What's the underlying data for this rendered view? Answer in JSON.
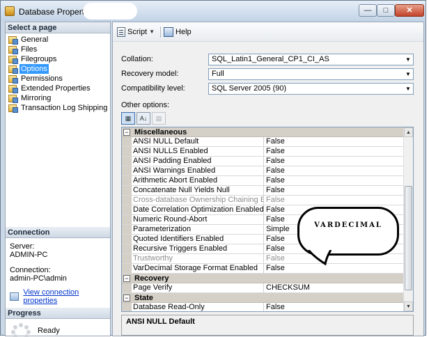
{
  "window": {
    "title": "Database Properties"
  },
  "title_buttons": {
    "minimize": "—",
    "maximize": "□",
    "close": "✕"
  },
  "left_pane": {
    "select_page_header": "Select a page",
    "pages": [
      {
        "label": "General",
        "selected": false
      },
      {
        "label": "Files",
        "selected": false
      },
      {
        "label": "Filegroups",
        "selected": false
      },
      {
        "label": "Options",
        "selected": true
      },
      {
        "label": "Permissions",
        "selected": false
      },
      {
        "label": "Extended Properties",
        "selected": false
      },
      {
        "label": "Mirroring",
        "selected": false
      },
      {
        "label": "Transaction Log Shipping",
        "selected": false
      }
    ],
    "connection_header": "Connection",
    "server_label": "Server:",
    "server_value": "ADMIN-PC",
    "connection_label": "Connection:",
    "connection_value": "admin-PC\\admin",
    "view_connection_link": "View connection properties",
    "progress_header": "Progress",
    "progress_status": "Ready"
  },
  "toolbar": {
    "script_label": "Script",
    "help_label": "Help"
  },
  "form": {
    "collation_label": "Collation:",
    "collation_value": "SQL_Latin1_General_CP1_CI_AS",
    "recovery_label": "Recovery model:",
    "recovery_value": "Full",
    "compat_label": "Compatibility level:",
    "compat_value": "SQL Server 2005 (90)",
    "other_options_label": "Other options:"
  },
  "property_grid": {
    "categories": [
      {
        "name": "Miscellaneous",
        "rows": [
          {
            "name": "ANSI NULL Default",
            "value": "False",
            "disabled": false
          },
          {
            "name": "ANSI NULLS Enabled",
            "value": "False",
            "disabled": false
          },
          {
            "name": "ANSI Padding Enabled",
            "value": "False",
            "disabled": false
          },
          {
            "name": "ANSI Warnings Enabled",
            "value": "False",
            "disabled": false
          },
          {
            "name": "Arithmetic Abort Enabled",
            "value": "False",
            "disabled": false
          },
          {
            "name": "Concatenate Null Yields Null",
            "value": "False",
            "disabled": false
          },
          {
            "name": "Cross-database Ownership Chaining Enabled",
            "value": "False",
            "disabled": true
          },
          {
            "name": "Date Correlation Optimization Enabled",
            "value": "False",
            "disabled": false
          },
          {
            "name": "Numeric Round-Abort",
            "value": "False",
            "disabled": false
          },
          {
            "name": "Parameterization",
            "value": "Simple",
            "disabled": false
          },
          {
            "name": "Quoted Identifiers Enabled",
            "value": "False",
            "disabled": false
          },
          {
            "name": "Recursive Triggers Enabled",
            "value": "False",
            "disabled": false
          },
          {
            "name": "Trustworthy",
            "value": "False",
            "disabled": true
          },
          {
            "name": "VarDecimal Storage Format Enabled",
            "value": "False",
            "disabled": false
          }
        ]
      },
      {
        "name": "Recovery",
        "rows": [
          {
            "name": "Page Verify",
            "value": "CHECKSUM",
            "disabled": false
          }
        ]
      },
      {
        "name": "State",
        "rows": [
          {
            "name": "Database Read-Only",
            "value": "False",
            "disabled": false
          }
        ]
      }
    ],
    "description_title": "ANSI NULL Default"
  },
  "callout": {
    "text": "VARDECIMAL"
  },
  "icons": {
    "app": "database-properties-icon",
    "page": "page-icon",
    "script": "script-icon",
    "help": "help-icon",
    "categorized": "categorized-icon",
    "alphabetical": "alphabetical-icon",
    "property_pages": "property-pages-icon",
    "connection": "view-connection-icon",
    "progress": "progress-spinner-icon"
  },
  "colors": {
    "selection": "#3399ff",
    "link": "#0033cc",
    "category_bg": "#d4d0c8"
  }
}
